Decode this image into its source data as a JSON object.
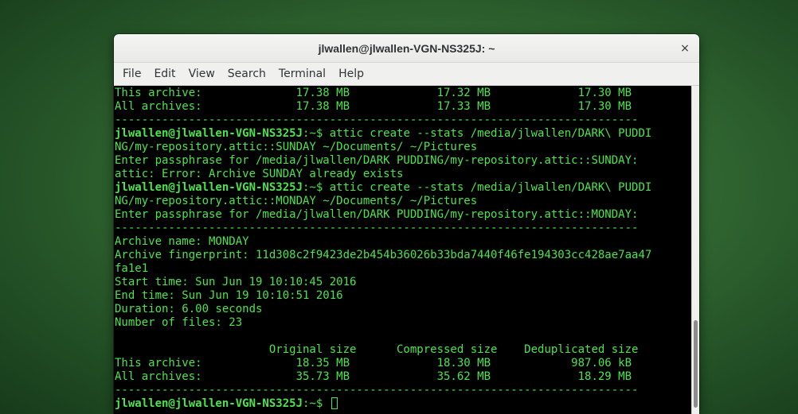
{
  "window": {
    "title": "jlwallen@jlwallen-VGN-NS325J: ~",
    "close_glyph": "×"
  },
  "menu": [
    {
      "label": "File"
    },
    {
      "label": "Edit"
    },
    {
      "label": "View"
    },
    {
      "label": "Search"
    },
    {
      "label": "Terminal"
    },
    {
      "label": "Help"
    }
  ],
  "terminal": {
    "text_color": "#4be44b",
    "background": "#000000",
    "prompt": "jlwallen@jlwallen-VGN-NS325J",
    "lines": [
      {
        "text": "This archive:              17.38 MB             17.32 MB             17.30 MB"
      },
      {
        "text": "All archives:              17.38 MB             17.33 MB             17.30 MB"
      },
      {
        "text": "------------------------------------------------------------------------------"
      },
      {
        "prompt": "jlwallen@jlwallen-VGN-NS325J",
        "text": ":~$ attic create --stats /media/jlwallen/DARK\\ PUDDI"
      },
      {
        "text": "NG/my-repository.attic::SUNDAY ~/Documents/ ~/Pictures"
      },
      {
        "text": "Enter passphrase for /media/jlwallen/DARK PUDDING/my-repository.attic::SUNDAY:"
      },
      {
        "text": "attic: Error: Archive SUNDAY already exists"
      },
      {
        "prompt": "jlwallen@jlwallen-VGN-NS325J",
        "text": ":~$ attic create --stats /media/jlwallen/DARK\\ PUDDI"
      },
      {
        "text": "NG/my-repository.attic::MONDAY ~/Documents/ ~/Pictures"
      },
      {
        "text": "Enter passphrase for /media/jlwallen/DARK PUDDING/my-repository.attic::MONDAY:"
      },
      {
        "text": "------------------------------------------------------------------------------"
      },
      {
        "text": "Archive name: MONDAY"
      },
      {
        "text": "Archive fingerprint: 11d308c2f9423de2b454b36026b33bda7440f46fe194303cc428ae7aa47"
      },
      {
        "text": "fa1e1"
      },
      {
        "text": "Start time: Sun Jun 19 10:10:45 2016"
      },
      {
        "text": "End time: Sun Jun 19 10:10:51 2016"
      },
      {
        "text": "Duration: 6.00 seconds"
      },
      {
        "text": "Number of files: 23"
      },
      {
        "text": ""
      },
      {
        "text": "                       Original size      Compressed size    Deduplicated size"
      },
      {
        "text": "This archive:              18.35 MB             18.30 MB            987.06 kB"
      },
      {
        "text": "All archives:              35.73 MB             35.62 MB             18.29 MB"
      },
      {
        "text": "------------------------------------------------------------------------------"
      },
      {
        "prompt": "jlwallen@jlwallen-VGN-NS325J",
        "text": ":~$ ",
        "cursor": true
      }
    ]
  }
}
